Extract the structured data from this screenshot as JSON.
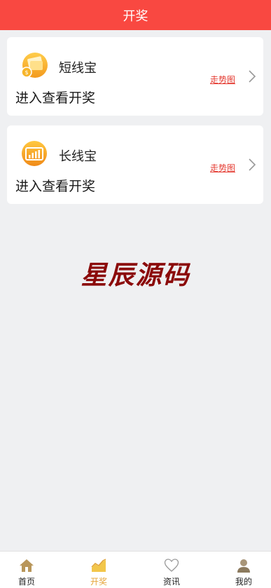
{
  "header": {
    "title": "开奖"
  },
  "cards": [
    {
      "name": "短线宝",
      "enter_label": "进入查看开奖",
      "trend_label": "走势图",
      "icon": "wallet-coin-icon"
    },
    {
      "name": "长线宝",
      "enter_label": "进入查看开奖",
      "trend_label": "走势图",
      "icon": "bar-chart-icon"
    }
  ],
  "watermark": "星辰源码",
  "tabbar": {
    "items": [
      {
        "label": "首页",
        "icon": "home-icon"
      },
      {
        "label": "开奖",
        "icon": "chart-icon",
        "active": true
      },
      {
        "label": "资讯",
        "icon": "heart-icon"
      },
      {
        "label": "我的",
        "icon": "user-icon"
      }
    ]
  },
  "colors": {
    "header": "#f94841",
    "active_tab": "#e6a53a",
    "trend_link": "#e4392f",
    "watermark": "#8b0a0a",
    "background": "#eff0f2"
  }
}
